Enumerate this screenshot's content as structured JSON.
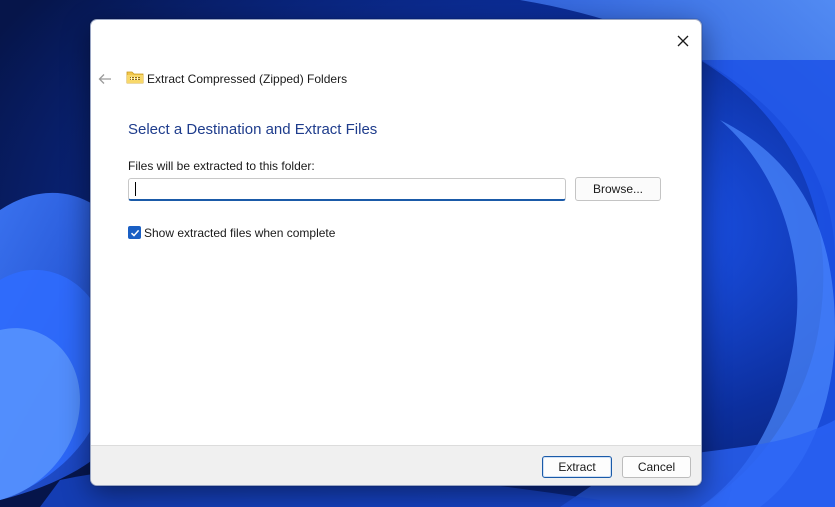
{
  "window": {
    "title": "Extract Compressed (Zipped) Folders",
    "close_icon": "close-icon",
    "back_icon": "arrow-left-icon",
    "folder_icon": "zipped-folder-icon"
  },
  "main": {
    "heading": "Select a Destination and Extract Files",
    "path_label": "Files will be extracted to this folder:",
    "path_value": "",
    "browse_label": "Browse...",
    "show_files_checked": true,
    "show_files_label": "Show extracted files when complete"
  },
  "footer": {
    "extract_label": "Extract",
    "cancel_label": "Cancel"
  },
  "colors": {
    "heading": "#1e3c8c",
    "accent": "#1a5fc4",
    "footer_bg": "#f0f0f0",
    "desktop": "#0a2a8a"
  }
}
